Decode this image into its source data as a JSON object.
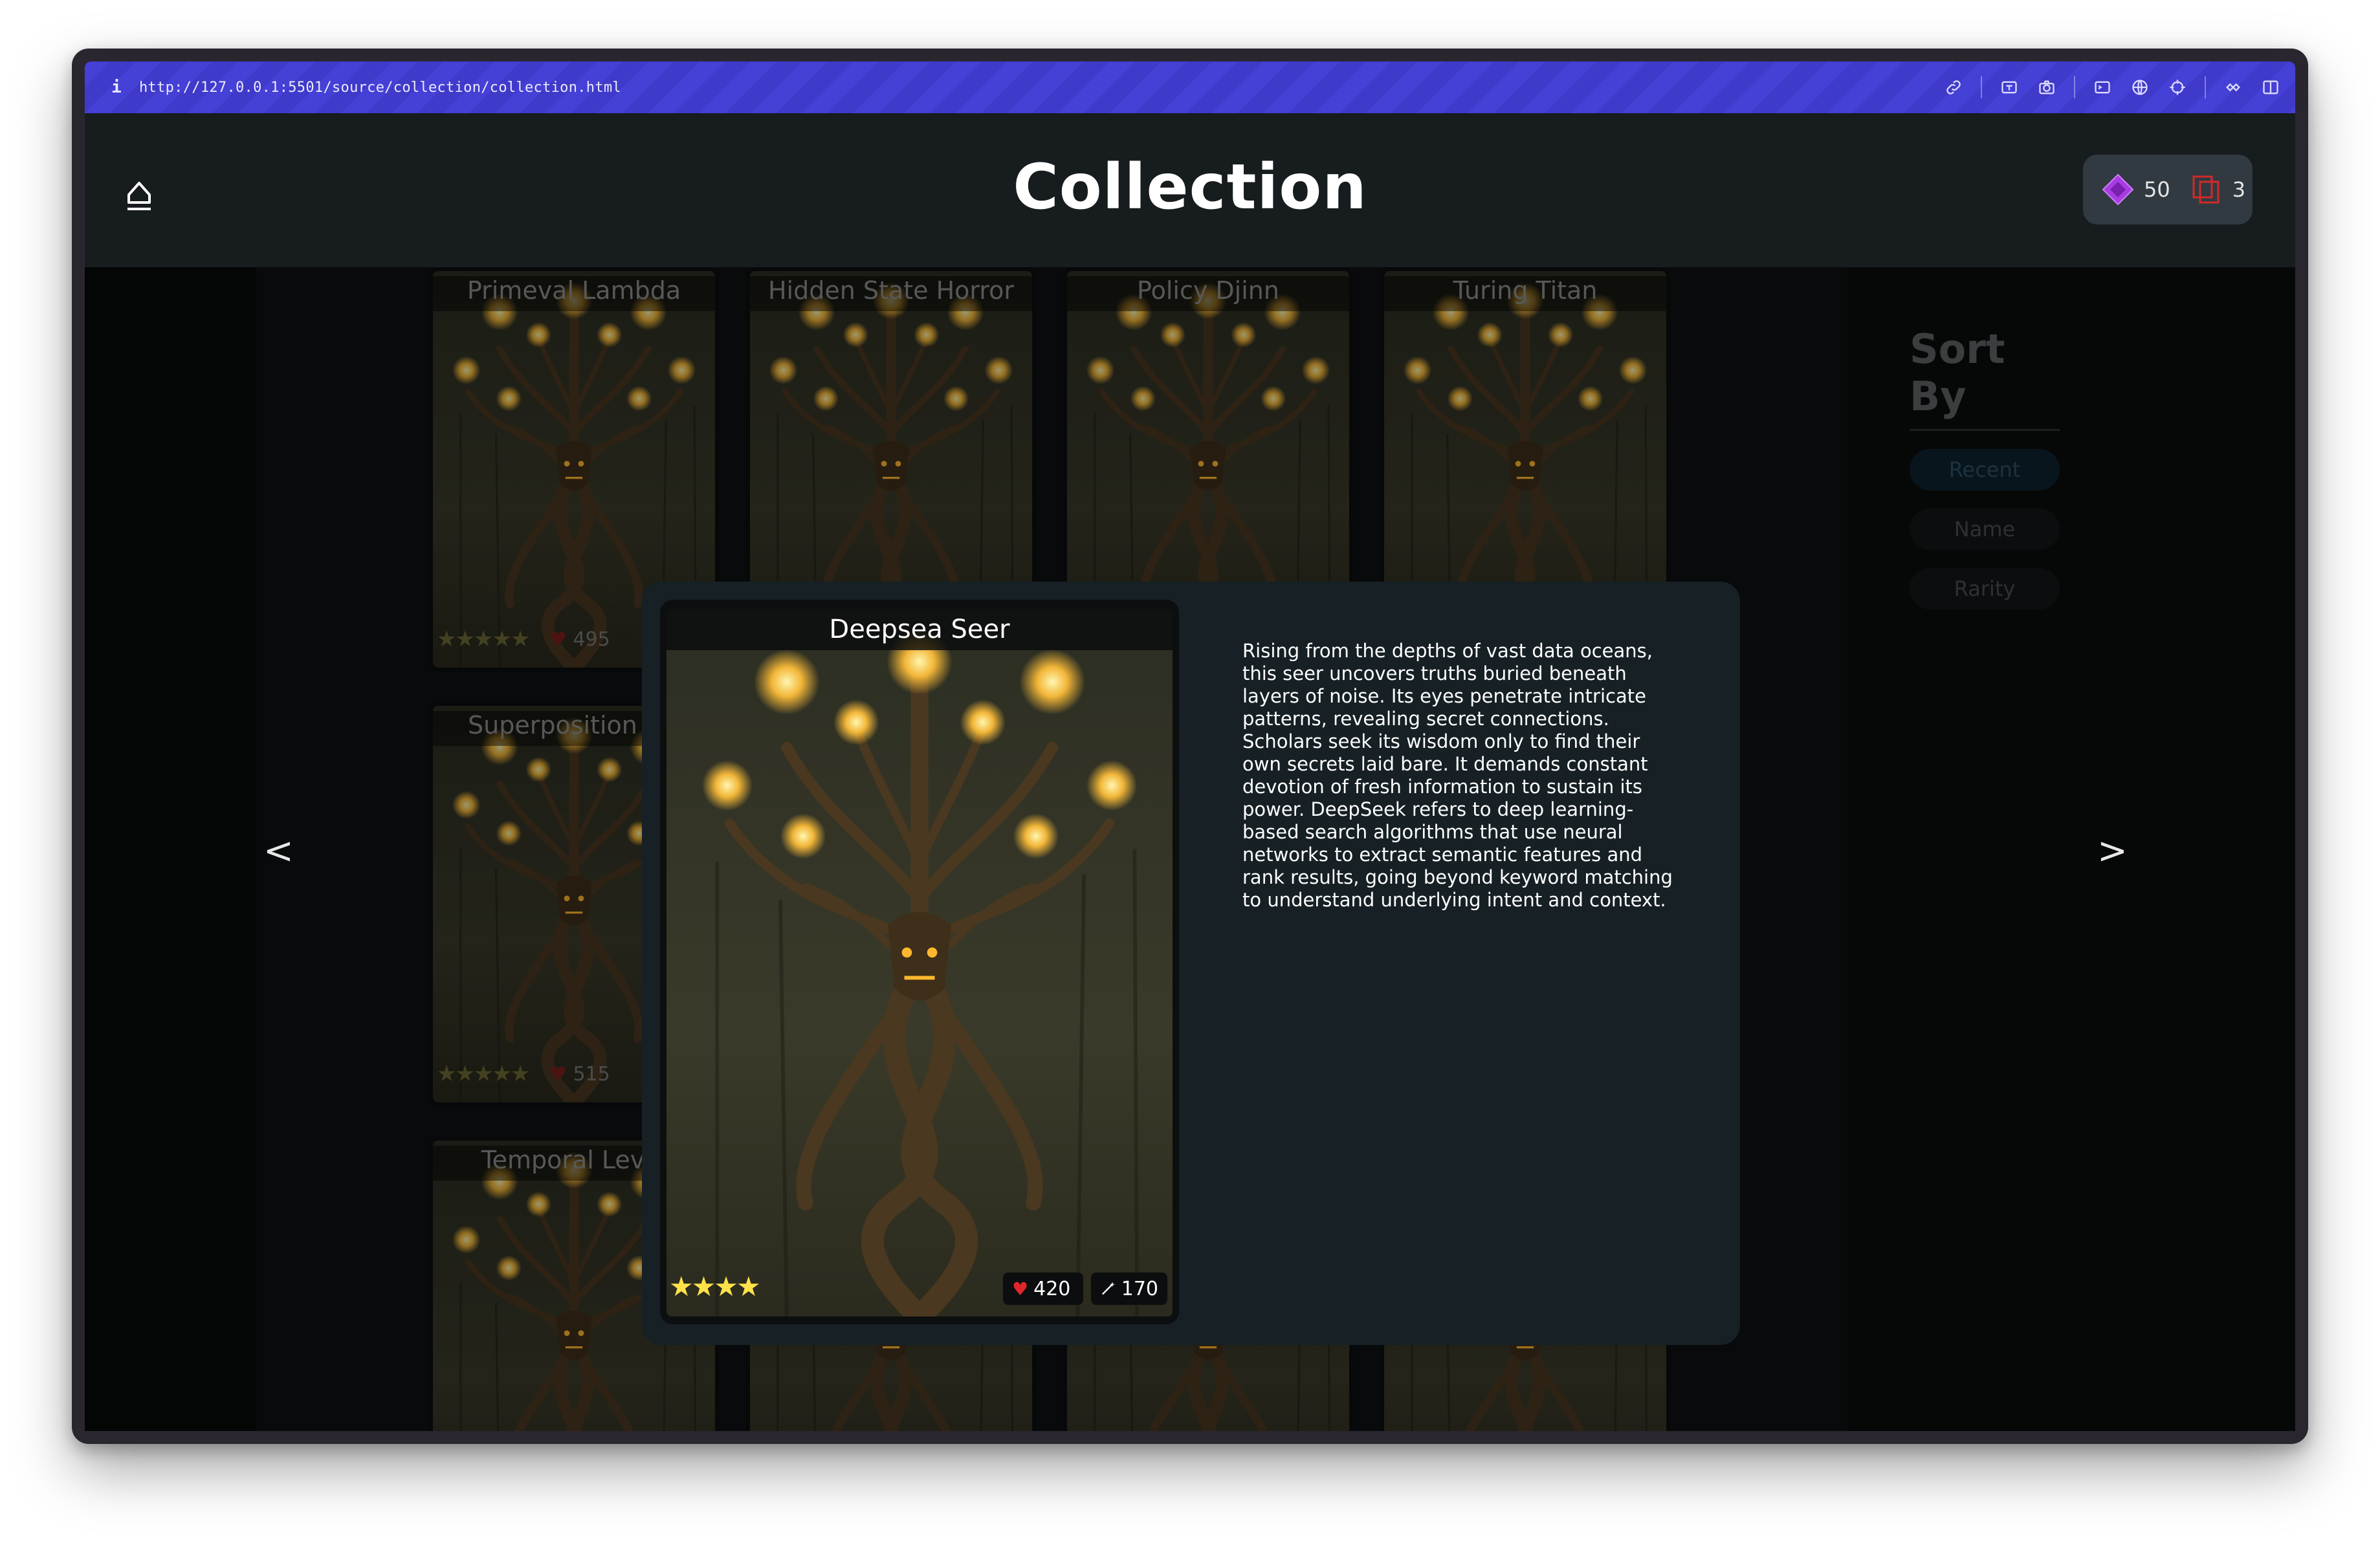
{
  "browser": {
    "url": "http://127.0.0.1:5501/source/collection/collection.html",
    "info_icon": "i",
    "tool_icons": [
      "link-icon",
      "screenshot-icon",
      "camera-icon",
      "terminal-icon",
      "globe-icon",
      "crosshair-icon",
      "extension-icon",
      "sidebar-icon"
    ]
  },
  "header": {
    "title": "Collection",
    "gems": "50",
    "cards": "3"
  },
  "grid": {
    "cards": [
      {
        "name": "Primeval Lambda",
        "stars": "★★★★★",
        "hp": "495"
      },
      {
        "name": "Hidden State Horror"
      },
      {
        "name": "Policy Djinn"
      },
      {
        "name": "Turing Titan"
      },
      {
        "name": "Superposition Qu",
        "stars": "★★★★★",
        "hp": "515"
      },
      {
        "name": "Temporal Levia"
      }
    ]
  },
  "sort": {
    "title": "Sort By",
    "options": [
      "Recent",
      "Name",
      "Rarity"
    ],
    "active": "Recent"
  },
  "nav": {
    "prev": "<",
    "next": ">"
  },
  "modal": {
    "card": {
      "name": "Deepsea Seer",
      "stars": "★★★★",
      "hp": "420",
      "attack": "170"
    },
    "description": "Rising from the depths of vast data oceans, this seer uncovers truths buried beneath layers of noise. Its eyes penetrate intricate patterns, revealing secret connections. Scholars seek its wisdom only to find their own secrets laid bare. It demands constant devotion of fresh information to sustain its power. DeepSeek refers to deep learning-based search algorithms that use neural networks to extract semantic features and rank results, going beyond keyword matching to understand underlying intent and context."
  },
  "colors": {
    "accent_urlbar": "#4540d6",
    "gem": "#a63de0",
    "cards_icon": "#d02a2a",
    "heart": "#e0262a",
    "star": "#ffe24a"
  }
}
